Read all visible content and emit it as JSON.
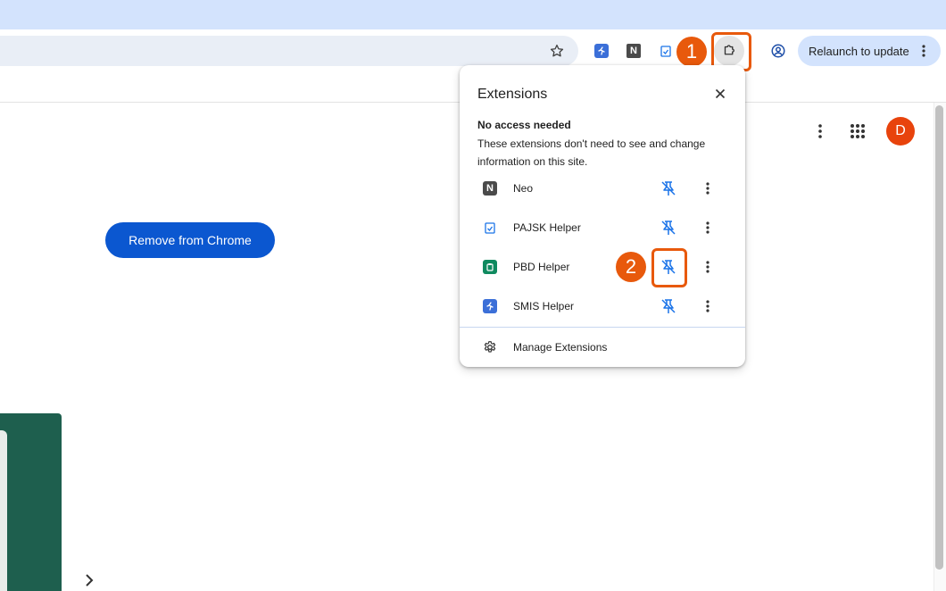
{
  "toolbar": {
    "relaunch_label": "Relaunch to update"
  },
  "page": {
    "remove_button_label": "Remove from Chrome",
    "avatar_letter": "D"
  },
  "annotations": {
    "marker_1": "1",
    "marker_2": "2",
    "accent_color": "#e8590c"
  },
  "extensions_popup": {
    "title": "Extensions",
    "section_title": "No access needed",
    "section_desc": "These extensions don't need to see and change information on this site.",
    "items": [
      {
        "name": "Neo",
        "icon": "neo-icon",
        "pinned": false
      },
      {
        "name": "PAJSK Helper",
        "icon": "clipboard-check-icon",
        "pinned": false
      },
      {
        "name": "PBD Helper",
        "icon": "clipboard-icon",
        "pinned": false
      },
      {
        "name": "SMIS Helper",
        "icon": "runner-icon",
        "pinned": false
      }
    ],
    "manage_label": "Manage Extensions"
  },
  "colors": {
    "tabstrip": "#d3e3fd",
    "primary_button": "#0b57d0",
    "avatar": "#e8430c",
    "pin_icon": "#1a73e8"
  }
}
